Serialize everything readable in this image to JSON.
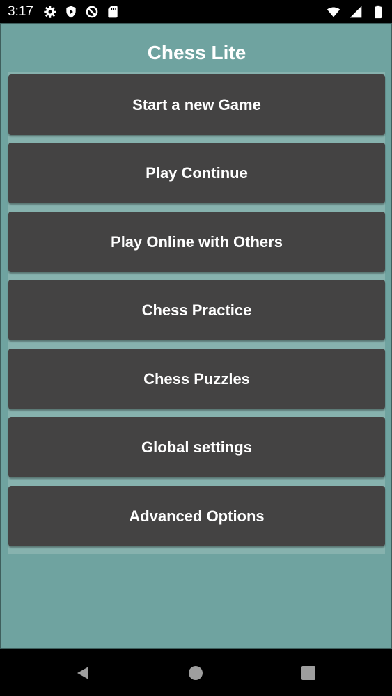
{
  "status_bar": {
    "time": "3:17",
    "left_icons": [
      "settings-icon",
      "play-protect-icon",
      "no-sync-icon",
      "sd-card-icon"
    ],
    "right_icons": [
      "wifi-icon",
      "signal-icon",
      "battery-icon"
    ]
  },
  "app": {
    "title": "Chess Lite",
    "background_color": "#6fa3a0",
    "button_color": "#444343",
    "menu": [
      {
        "label": "Start a new Game"
      },
      {
        "label": "Play Continue"
      },
      {
        "label": "Play Online with Others"
      },
      {
        "label": "Chess Practice"
      },
      {
        "label": "Chess Puzzles"
      },
      {
        "label": "Global settings"
      },
      {
        "label": "Advanced Options"
      }
    ]
  },
  "nav_bar": {
    "icons": [
      "back-icon",
      "home-icon",
      "recent-apps-icon"
    ]
  }
}
